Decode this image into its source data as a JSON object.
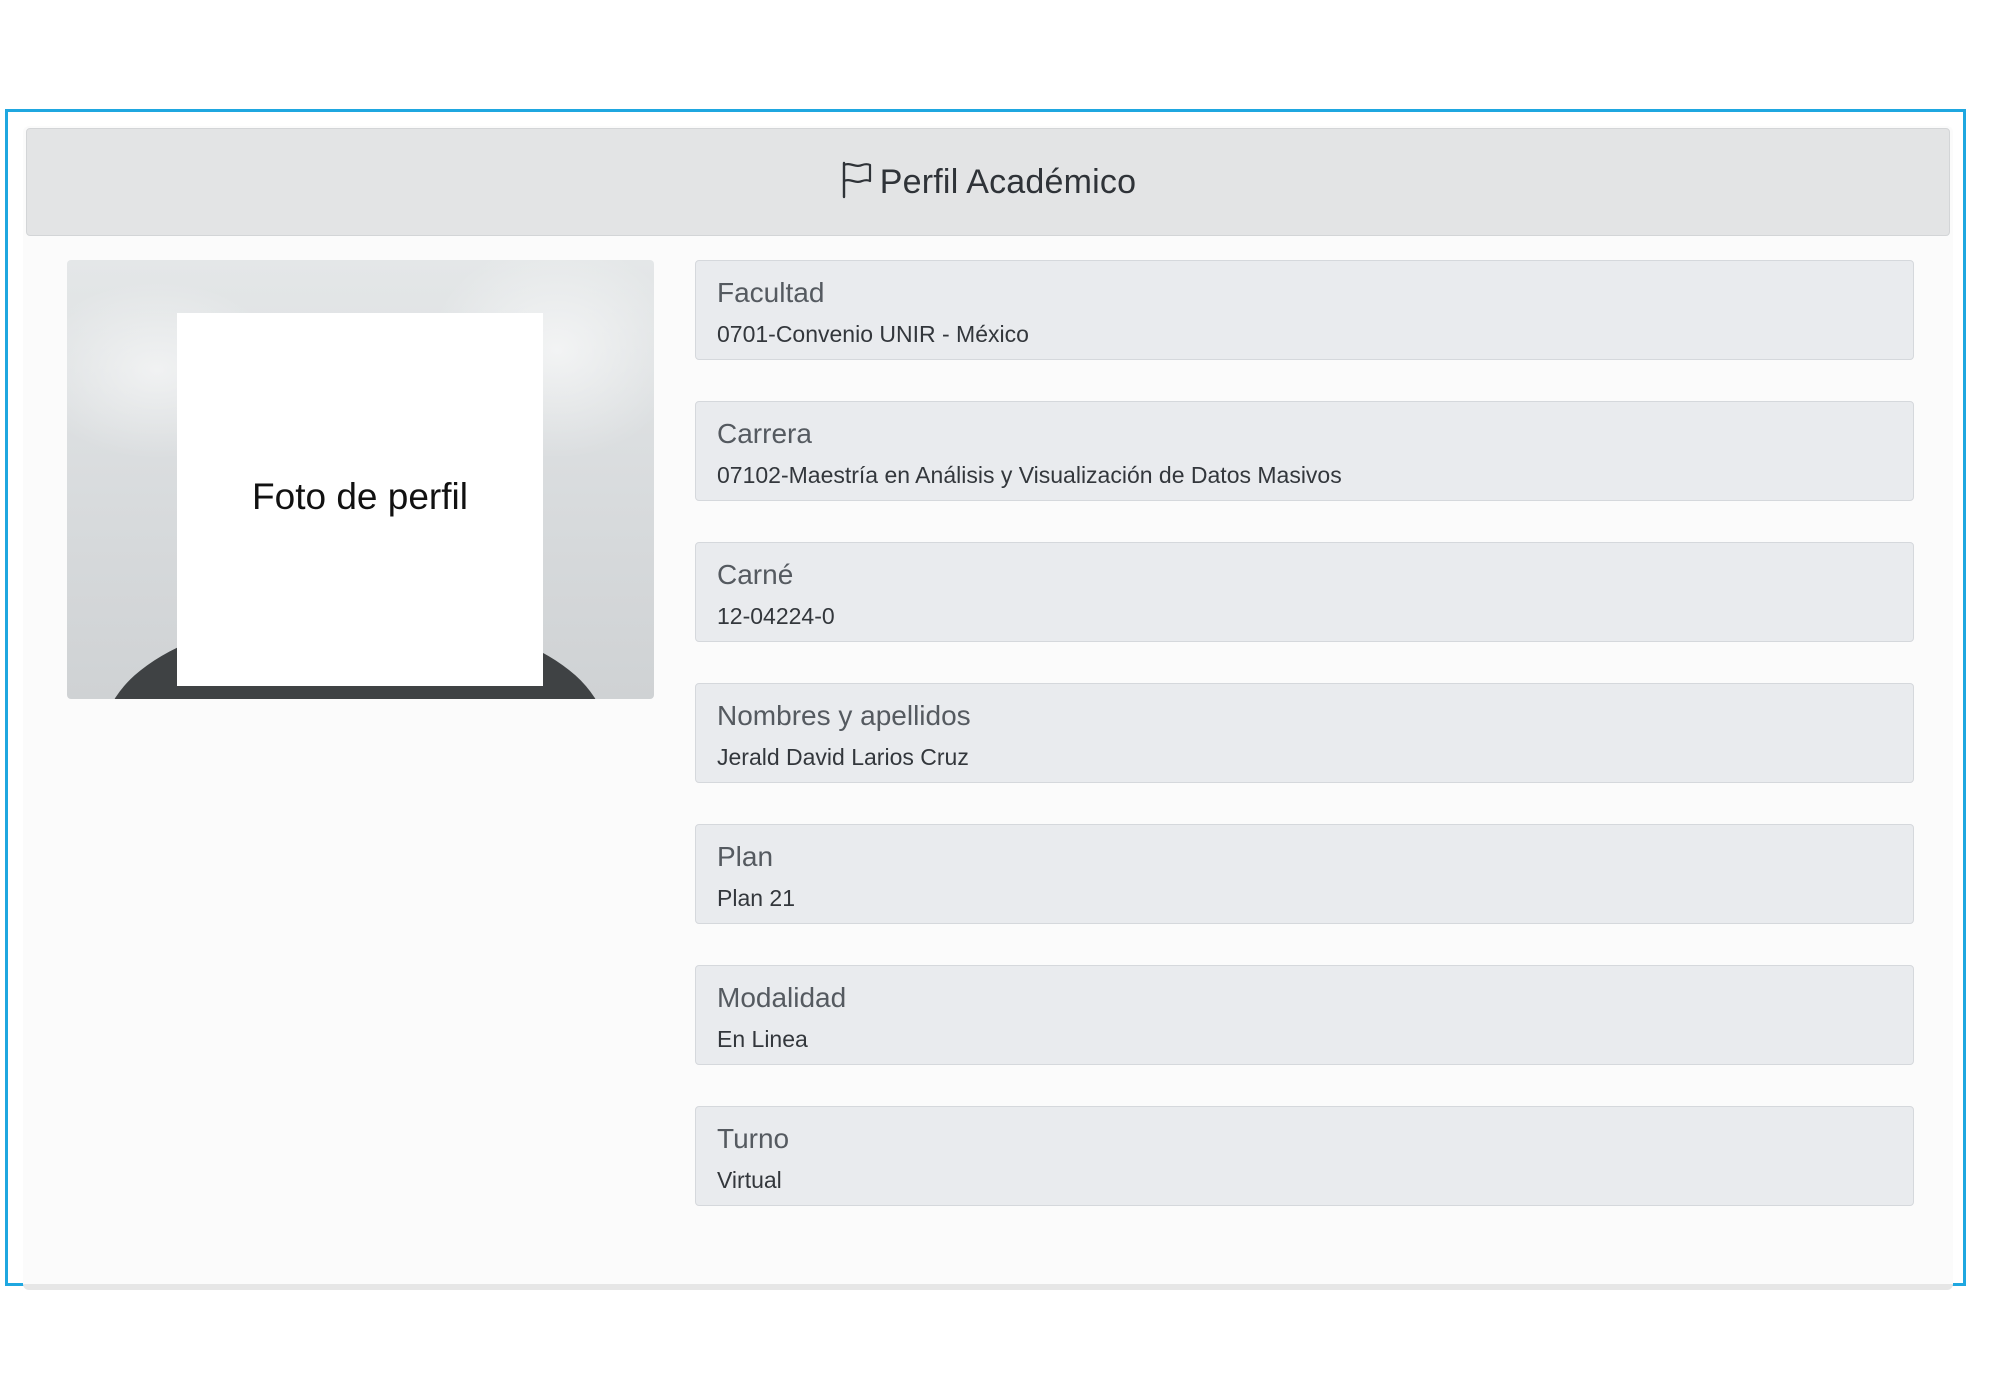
{
  "header": {
    "icon": "flag-icon",
    "title": "Perfil Académico"
  },
  "photo": {
    "placeholder_label": "Foto de perfil"
  },
  "fields": [
    {
      "label": "Facultad",
      "value": "0701-Convenio UNIR - México"
    },
    {
      "label": "Carrera",
      "value": "07102-Maestría en Análisis y Visualización de Datos Masivos"
    },
    {
      "label": "Carné",
      "value": "12-04224-0"
    },
    {
      "label": "Nombres y apellidos",
      "value": "Jerald David Larios Cruz"
    },
    {
      "label": "Plan",
      "value": "Plan 21"
    },
    {
      "label": "Modalidad",
      "value": "En Linea"
    },
    {
      "label": "Turno",
      "value": "Virtual"
    }
  ],
  "colors": {
    "frame_border": "#1fa7e0",
    "header_bg": "#e3e4e5",
    "field_bg": "#e9ebee"
  }
}
